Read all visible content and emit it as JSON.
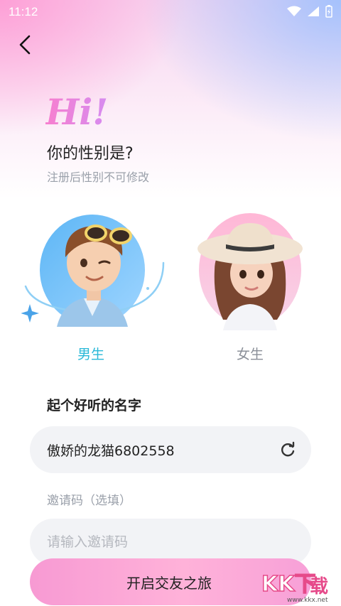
{
  "status": {
    "time": "11:12"
  },
  "header": {
    "greeting": "Hi!",
    "question": "你的性别是?",
    "subtitle": "注册后性别不可修改"
  },
  "gender": {
    "male_label": "男生",
    "female_label": "女生",
    "selected": "male",
    "selected_color": "#29b8d8"
  },
  "name": {
    "title": "起个好听的名字",
    "value": "傲娇的龙猫6802558"
  },
  "invite": {
    "label": "邀请码（选填）",
    "placeholder": "请输入邀请码"
  },
  "cta": {
    "label": "开启交友之旅"
  },
  "watermark": {
    "logo_text": "KK下载",
    "url": "www.kkx.net"
  }
}
